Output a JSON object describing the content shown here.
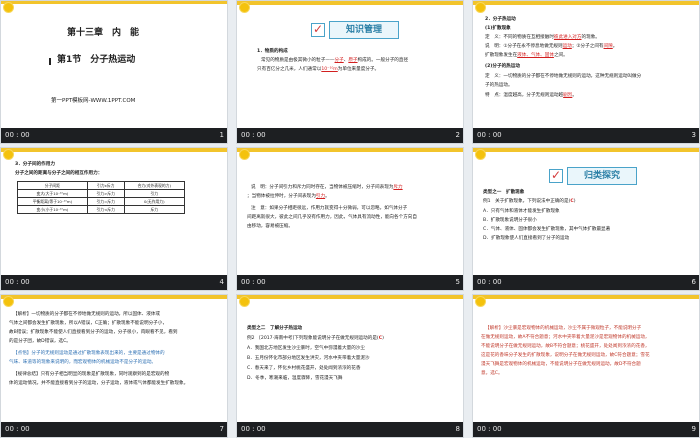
{
  "slides": [
    {
      "num": "1",
      "time": "00 : 00",
      "chapter": "第十三章　内　能",
      "section": "第1节　分子热运动",
      "footer": "第一PPT模板网-WWW.1PPT.COM"
    },
    {
      "num": "2",
      "time": "00 : 00",
      "header": "知识管理",
      "lines": [
        "1．物质的构成",
        "常见的物质是由极其微小的粒子——",
        "分子",
        "、",
        "原子",
        "构成的。一般分子的直径",
        "只有百亿分之几米，人们通常以",
        "10⁻¹⁰m",
        "为单位来量度分子。"
      ]
    },
    {
      "num": "3",
      "time": "00 : 00",
      "lines": [
        "2．分子热运动",
        "(1)扩散现象",
        "定　义：不同的物质在互相接触时",
        "彼此进入对方",
        "的现象。",
        "说　明：①分子在永不停息地做无规则",
        "运动",
        "；②分子之间",
        "有",
        "间隙",
        "。",
        "扩散现象发生在",
        "液体、气体、固体",
        "之间。",
        "(2)分子的热运动",
        "定　义：一切物质的分子都在不停地做无规则的运动，这种无规则运动叫做分",
        "子的热运动。",
        "特　点：温度越高，分子无规则运动越",
        "剧烈",
        "。"
      ]
    },
    {
      "num": "4",
      "time": "00 : 00",
      "lines": [
        "3．分子间的作用力",
        "分子之间的距离与分子之间的相互作用力："
      ],
      "table": [
        [
          "分子间距",
          "引力ⅹ斥力",
          "合力(对外表现的力)"
        ],
        [
          "变大(大于10⁻¹⁰m)",
          "引力>斥力",
          "引力"
        ],
        [
          "平衡距离(等于10⁻¹⁰m)",
          "引力=斥力",
          "0(无作用力)"
        ],
        [
          "变小(小于10⁻¹⁰m)",
          "引力<斥力",
          "斥力"
        ]
      ]
    },
    {
      "num": "5",
      "time": "00 : 00",
      "lines": [
        "说　明：分子间引力和斥力同时存在，当物体被压缩时，分子间表现为",
        "斥力",
        "；当物体被拉伸时，分子间表现为",
        "引力",
        "。",
        "注　意：如果分子相距很远，作用力就变得十分微弱，可以忽略，如气体分子",
        "间距离就很大，彼此之间几乎没有作用力，因此，气体具有流动性，能向各个方向自",
        "由移动，容易被压缩。"
      ]
    },
    {
      "num": "6",
      "time": "00 : 00",
      "header": "归类探究",
      "lines": [
        "类型之一　扩散现象",
        "例1　关于扩散现象，下列说法中正确的是(",
        "C",
        ")",
        "A．只有气体和液体才能发生扩散现象",
        "B．扩散现象说明分子很小",
        "C．气体、液体、固体都会发生扩散现象，其中气体扩散最显著",
        "D．扩散现象使人们直接看到了分子的运动"
      ]
    },
    {
      "num": "7",
      "time": "00 : 00",
      "lines": [
        "【解析】一切物质的分子都在不停地做无规则的运动，所以固体、液体或",
        "气体之间都会发生扩散现象，所以A错误，C正确；扩散现象不能说明分子小，",
        "故B错误；扩散现象不能使人们直接看到分子的运动，分子很小，肉眼看不见，看到",
        "的是分子团，故D错误，选C。",
        "【点悟】分子的无规则运动是通过扩散现象表现出来的，主要是通过物体的",
        "气味、味道等的现象来说明的，而宏观物体的机械运动不是分子的运动。",
        "【规律总结】只有分子相当明显的现象是扩散现象，同时观察到的是宏观的物",
        "体的运动情况，并不能直接看到分子的运动，分子运动，液体或气体都能发生扩散现象。"
      ]
    },
    {
      "num": "8",
      "time": "00 : 00",
      "lines": [
        "类型之二　了解分子热运动",
        "例2　[2017·海南中考]下列现象能说明分子在做无规则运动的是(",
        "C",
        ")",
        "A．我国北方地区发生沙尘暴时，空气中弥漫着大量的沙尘",
        "B．五月份怀化市部分地区发生洪灾，河水中夹带着大量泥沙",
        "C．春天来了，怀化乡村桃花盛开，处处闻到浓浓的花香",
        "D．冬季，寒潮来临，温度骤降，雪花漫天飞舞"
      ]
    },
    {
      "num": "9",
      "time": "00 : 00",
      "lines": [
        "【解析】沙尘暴是宏观物体的机械运动，沙尘不属于微观粒子，不能说明分子",
        "在做无规则运动，故A不符合题意；河水中夹带着大量泥沙是宏观物体的机械运动，",
        "不能说明分子在做无规则运动，故B不符合题意；桃花盛开，处处闻到浓浓的花香，",
        "这是花的香味分子发生的扩散现象，说明分子在做无规则运动，故C符合题意；雪花",
        "漫天飞舞是宏观物体的机械运动，不能说明分子在做无规则运动，故D不符合题",
        "意。选C。"
      ]
    }
  ]
}
